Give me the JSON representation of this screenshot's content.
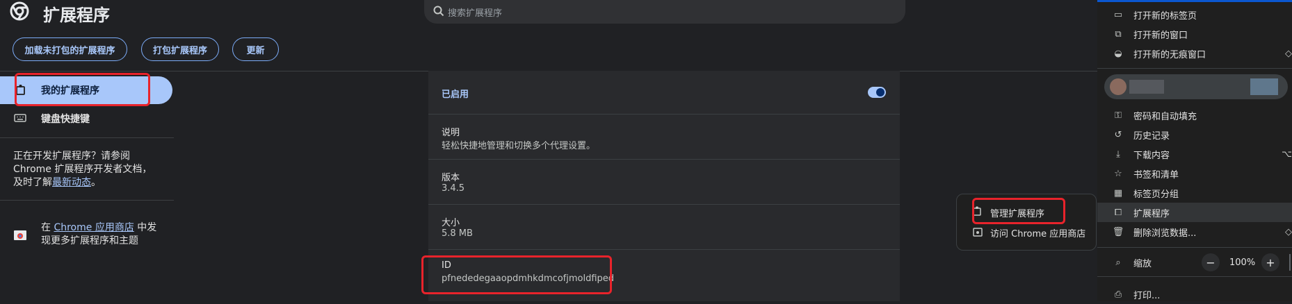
{
  "header": {
    "title": "扩展程序",
    "search_placeholder": "搜索扩展程序"
  },
  "toolbar": {
    "load_unpacked": "加载未打包的扩展程序",
    "pack": "打包扩展程序",
    "update": "更新"
  },
  "sidebar": {
    "my_extensions": "我的扩展程序",
    "shortcuts": "键盘快捷键",
    "dev_text_1": "正在开发扩展程序？请参阅",
    "dev_text_2": "Chrome 扩展程序开发者文档，",
    "dev_text_3": "及时了解",
    "dev_link": "最新动态",
    "dev_end": "。",
    "store_prefix": "在 ",
    "store_link": "Chrome 应用商店",
    "store_suffix": " 中发",
    "store_line2": "现更多扩展程序和主题"
  },
  "details": {
    "enabled_label": "已启用",
    "enabled": true,
    "description_label": "说明",
    "description": "轻松快捷地管理和切换多个代理设置。",
    "version_label": "版本",
    "version": "3.4.5",
    "size_label": "大小",
    "size": "5.8 MB",
    "id_label": "ID",
    "id": "pfnededegaaopdmhkdmcofjmoldfiped"
  },
  "submenu": {
    "manage": "管理扩展程序",
    "store": "访问 Chrome 应用商店"
  },
  "menu": {
    "new_tab": "打开新的标签页",
    "new_window": "打开新的窗口",
    "incognito": "打开新的无痕窗口",
    "passwords": "密码和自动填充",
    "history": "历史记录",
    "downloads": "下载内容",
    "bookmarks": "书签和清单",
    "tab_groups": "标签页分组",
    "extensions": "扩展程序",
    "clear_data": "删除浏览数据...",
    "zoom": "缩放",
    "zoom_value": "100%",
    "print": "打印..."
  },
  "colors": {
    "accent": "#a8c7fa",
    "highlight_box": "#e8232b",
    "background": "#202124"
  }
}
